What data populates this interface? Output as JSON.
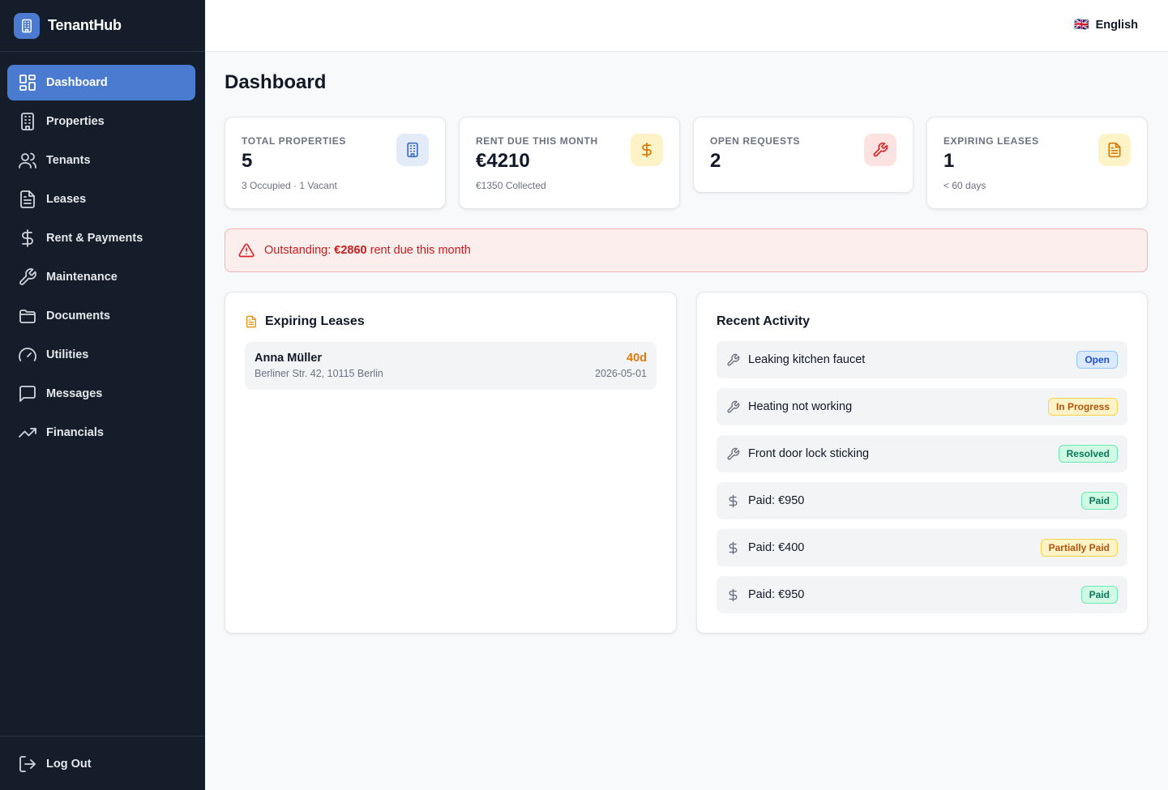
{
  "app": {
    "name": "TenantHub"
  },
  "sidebar": {
    "items": [
      {
        "label": "Dashboard",
        "icon": "dashboard-icon",
        "active": true
      },
      {
        "label": "Properties",
        "icon": "building-icon"
      },
      {
        "label": "Tenants",
        "icon": "users-icon"
      },
      {
        "label": "Leases",
        "icon": "document-icon"
      },
      {
        "label": "Rent & Payments",
        "icon": "dollar-icon"
      },
      {
        "label": "Maintenance",
        "icon": "wrench-icon"
      },
      {
        "label": "Documents",
        "icon": "folder-icon"
      },
      {
        "label": "Utilities",
        "icon": "gauge-icon"
      },
      {
        "label": "Messages",
        "icon": "message-icon"
      },
      {
        "label": "Financials",
        "icon": "trending-up-icon"
      }
    ],
    "logout_label": "Log Out"
  },
  "topbar": {
    "language": "English",
    "flag": "🇬🇧"
  },
  "page": {
    "title": "Dashboard"
  },
  "stats": [
    {
      "label": "Total Properties",
      "value": "5",
      "sub": "3 Occupied · 1 Vacant",
      "icon": "building-icon",
      "color": "#3b6fc4"
    },
    {
      "label": "Rent Due This Month",
      "value": "€4210",
      "sub": "€1350 Collected",
      "icon": "dollar-icon",
      "color": "#d97706"
    },
    {
      "label": "Open Requests",
      "value": "2",
      "sub": "",
      "icon": "wrench-icon",
      "color": "#dc2626"
    },
    {
      "label": "Expiring Leases",
      "value": "1",
      "sub": "< 60 days",
      "icon": "document-icon",
      "color": "#d97706"
    }
  ],
  "alert": {
    "prefix": "Outstanding:",
    "amount": "€2860",
    "suffix": "rent due this month"
  },
  "expiring_leases": {
    "title": "Expiring Leases",
    "items": [
      {
        "name": "Anna Müller",
        "address": "Berliner Str. 42, 10115 Berlin",
        "days": "40d",
        "date": "2026-05-01"
      }
    ]
  },
  "recent_activity": {
    "title": "Recent Activity",
    "items": [
      {
        "text": "Leaking kitchen faucet",
        "icon": "wrench-icon",
        "status": "Open"
      },
      {
        "text": "Heating not working",
        "icon": "wrench-icon",
        "status": "In Progress"
      },
      {
        "text": "Front door lock sticking",
        "icon": "wrench-icon",
        "status": "Resolved"
      },
      {
        "text": "Paid: €950",
        "icon": "dollar-icon",
        "status": "Paid"
      },
      {
        "text": "Paid: €400",
        "icon": "dollar-icon",
        "status": "Partially Paid"
      },
      {
        "text": "Paid: €950",
        "icon": "dollar-icon",
        "status": "Paid"
      }
    ]
  }
}
